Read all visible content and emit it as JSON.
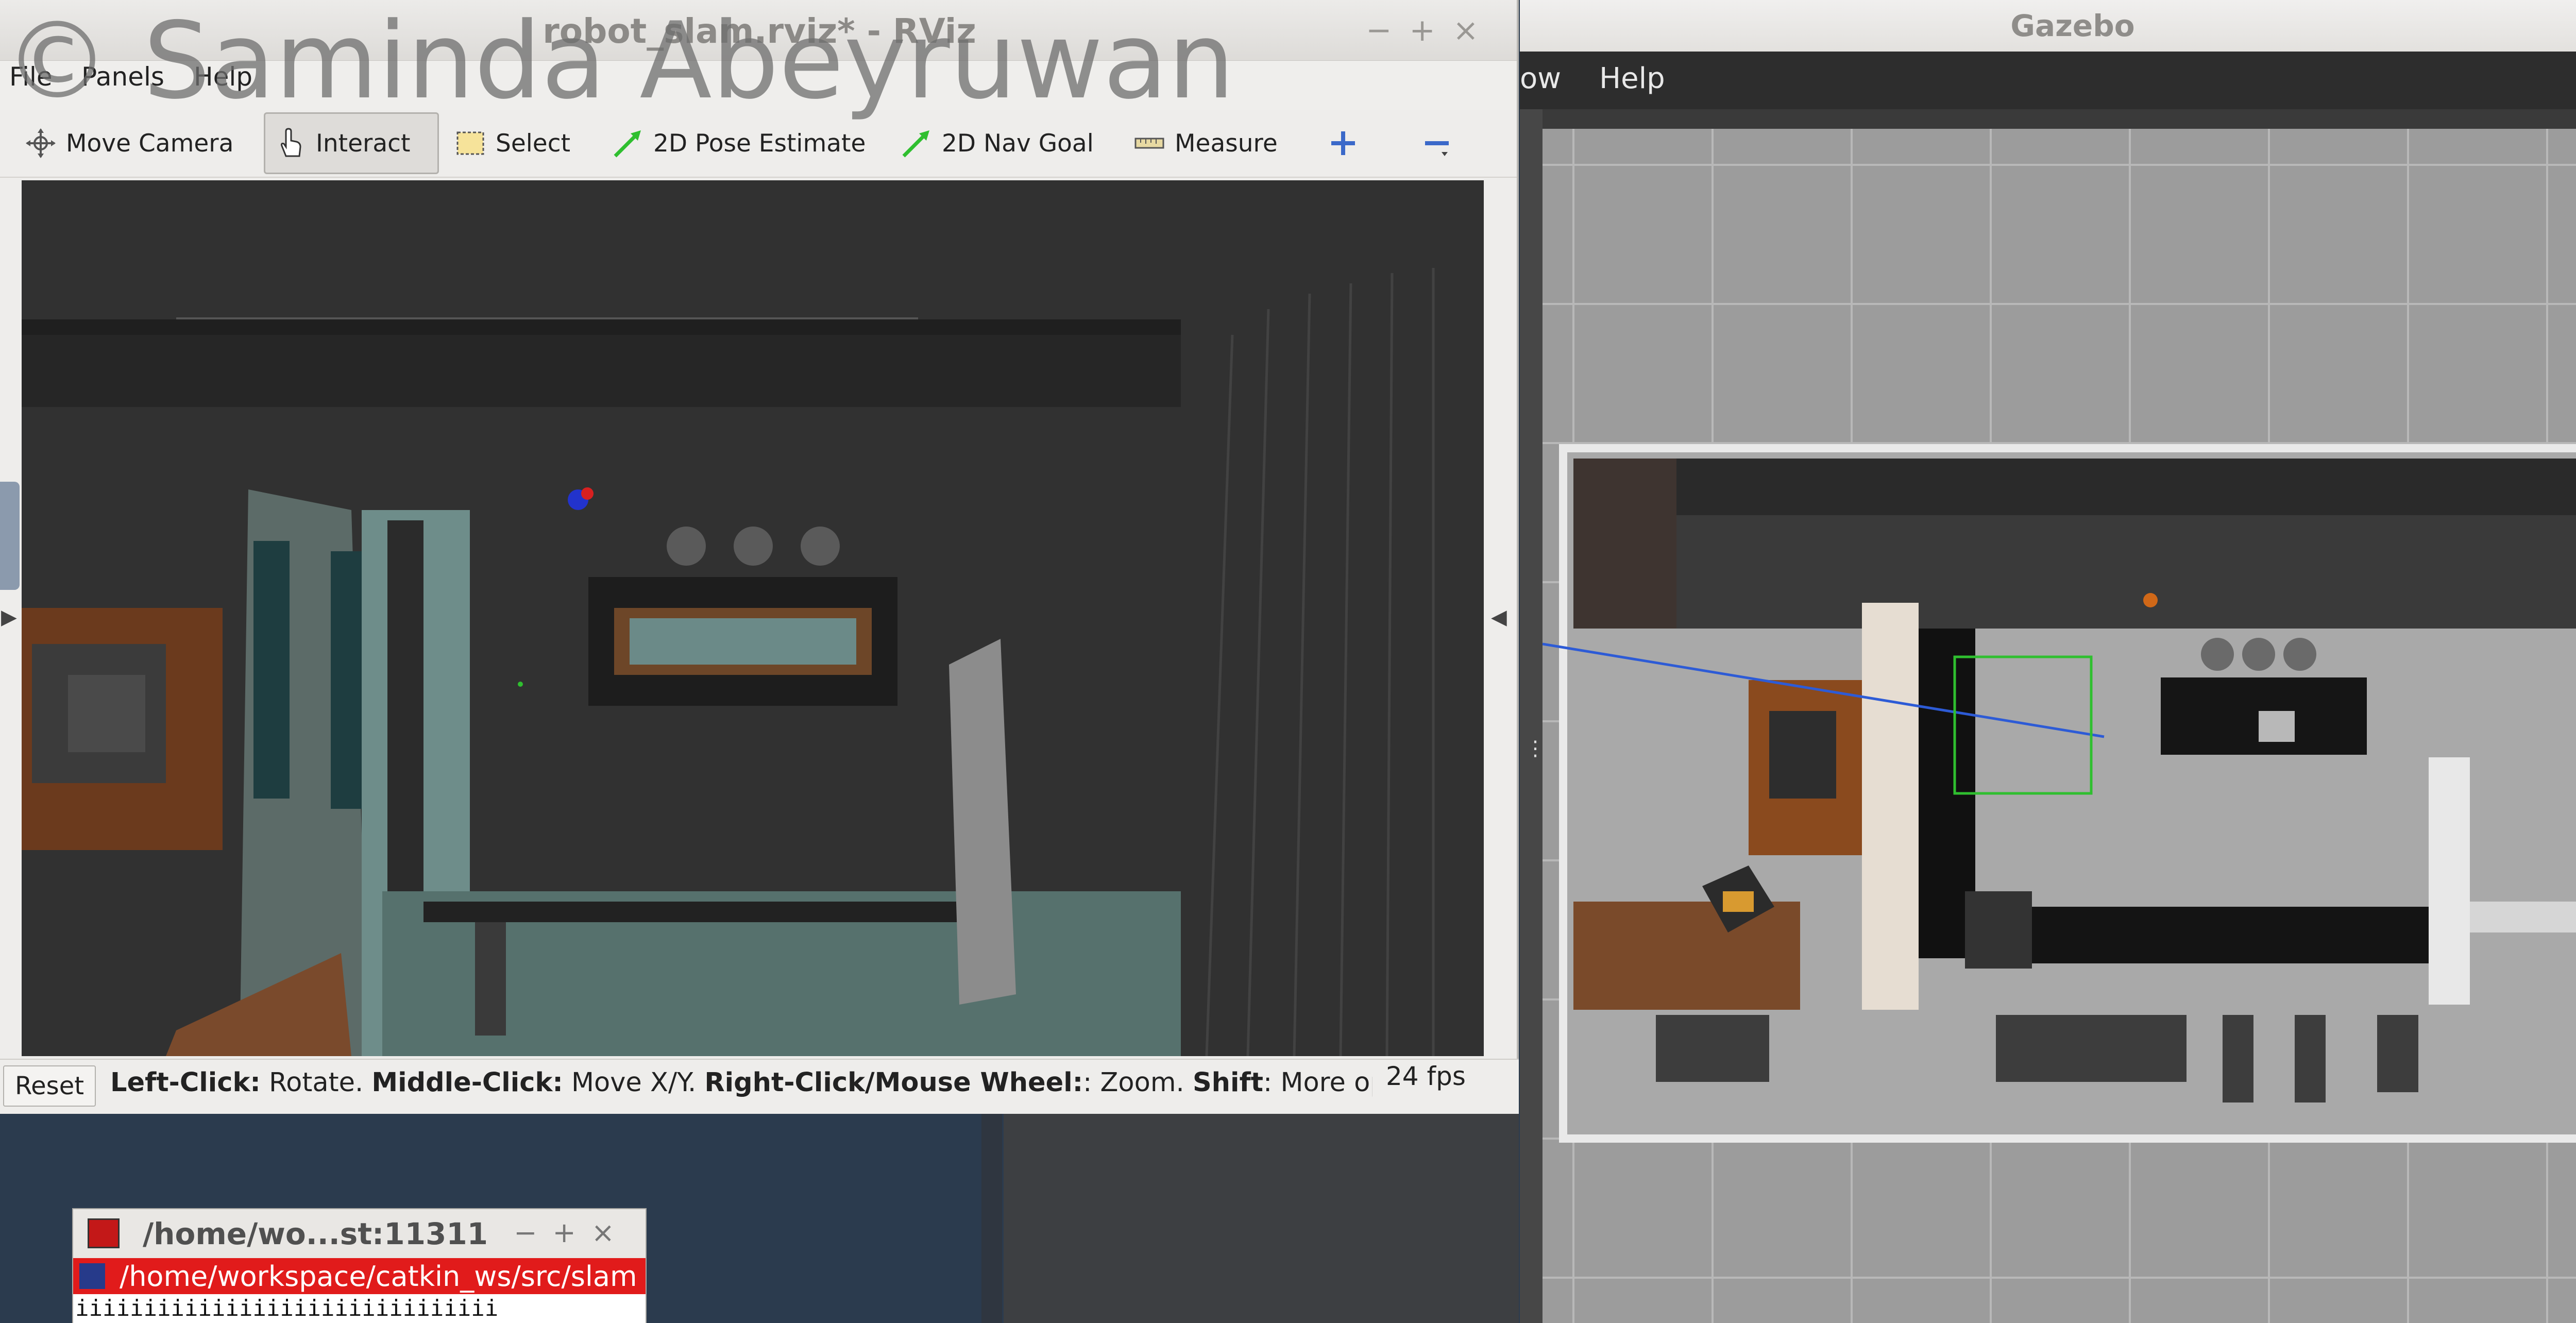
{
  "watermark": "© Saminda Abeyruwan",
  "rviz": {
    "title": "robot_slam.rviz* - RViz",
    "window_controls": [
      "−",
      "+",
      "×"
    ],
    "menu": [
      "File",
      "Panels",
      "Help"
    ],
    "toolbar": {
      "move_camera": "Move Camera",
      "interact": "Interact",
      "select": "Select",
      "pose_estimate": "2D Pose Estimate",
      "nav_goal": "2D Nav Goal",
      "measure": "Measure"
    },
    "status": {
      "reset": "Reset",
      "help_left_click": "Left-Click:",
      "help_rotate": "Rotate.",
      "help_middle_click": "Middle-Click:",
      "help_move": "Move X/Y.",
      "help_right_click": "Right-Click/Mouse Wheel:",
      "help_zoom": ": Zoom.",
      "help_shift": "Shift",
      "help_more": ": More options",
      "fps": "24 fps"
    }
  },
  "gazebo": {
    "title": "Gazebo",
    "menu": [
      "ow",
      "Help"
    ]
  },
  "terminal": {
    "title": "/home/wo...st:11311",
    "window_controls": [
      "−",
      "+",
      "×"
    ],
    "tab": "/home/workspace/catkin_ws/src/slam",
    "output_line": "iiiiiiiiiiiiiiiiiiiiiiiiiiiiiii"
  },
  "colors": {
    "accent_green": "#2fbf2f",
    "accent_blue": "#2d5bd6",
    "terminal_red": "#e11b1b"
  }
}
